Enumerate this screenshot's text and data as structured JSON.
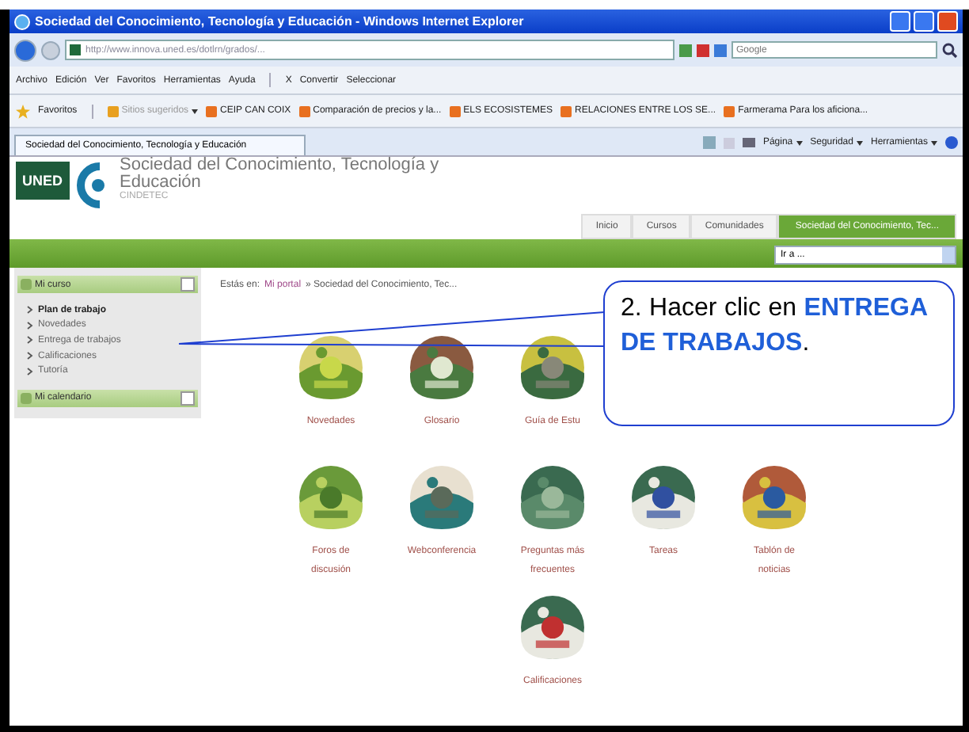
{
  "window": {
    "title": "Sociedad del Conocimiento, Tecnología y Educación - Windows Internet Explorer"
  },
  "address_bar": {
    "url": "http://www.innova.uned.es/dotlrn/grados/...",
    "search_placeholder": "Google"
  },
  "menu_bar": [
    "Archivo",
    "Edición",
    "Ver",
    "Favoritos",
    "Herramientas",
    "Ayuda"
  ],
  "toolbar": {
    "close": "X",
    "convert": "Convertir",
    "select": "Seleccionar"
  },
  "favorites_bar": {
    "label": "Favoritos",
    "items": [
      {
        "label": "Sitios sugeridos",
        "kind": "dropdown"
      },
      {
        "label": "CEIP CAN COIX",
        "kind": "link"
      },
      {
        "label": "Comparación de precios y la...",
        "kind": "link"
      },
      {
        "label": "ELS ECOSISTEMES",
        "kind": "link"
      },
      {
        "label": "RELACIONES ENTRE LOS SE...",
        "kind": "link"
      },
      {
        "label": "Farmerama Para los aficiona...",
        "kind": "link"
      }
    ]
  },
  "browser_tab": {
    "label": "Sociedad del Conocimiento, Tecnología y Educación",
    "selected": true
  },
  "command_bar": [
    "Página",
    "Seguridad",
    "Herramientas"
  ],
  "site": {
    "logo": "UNED",
    "title": "Sociedad del Conocimiento, Tecnología y Educación",
    "subtitle": "CINDETEC",
    "nav_tabs": [
      {
        "label": "Inicio",
        "selected": false
      },
      {
        "label": "Cursos",
        "selected": false
      },
      {
        "label": "Comunidades",
        "selected": false
      },
      {
        "label": "Sociedad del Conocimiento, Tec...",
        "selected": true
      }
    ],
    "goto_select": "Ir a ..."
  },
  "sidebar": {
    "blocks": [
      {
        "title": "Mi curso",
        "items": [
          {
            "label": "Plan de trabajo",
            "selected": true
          },
          {
            "label": "Novedades",
            "selected": false
          },
          {
            "label": "Entrega de trabajos",
            "selected": false
          },
          {
            "label": "Calificaciones",
            "selected": false
          },
          {
            "label": "Tutoría",
            "selected": false
          }
        ]
      },
      {
        "title": "Mi calendario"
      }
    ]
  },
  "breadcrumb": {
    "prefix": "Estás en:",
    "link": "Mi portal",
    "rest": "» Sociedad del Conocimiento, Tec..."
  },
  "tools": [
    {
      "label": "Novedades"
    },
    {
      "label": "Glosario"
    },
    {
      "label": "Guía de Estu"
    },
    {
      "label": "Foros de discusión"
    },
    {
      "label": "Webconferencia"
    },
    {
      "label": "Preguntas más frecuentes"
    },
    {
      "label": "Tareas"
    },
    {
      "label": "Tablón de noticias"
    },
    {
      "label": "Calificaciones"
    }
  ],
  "callout": {
    "text": "2. Hacer clic en **ENTREGA DE TRABAJOS**."
  }
}
